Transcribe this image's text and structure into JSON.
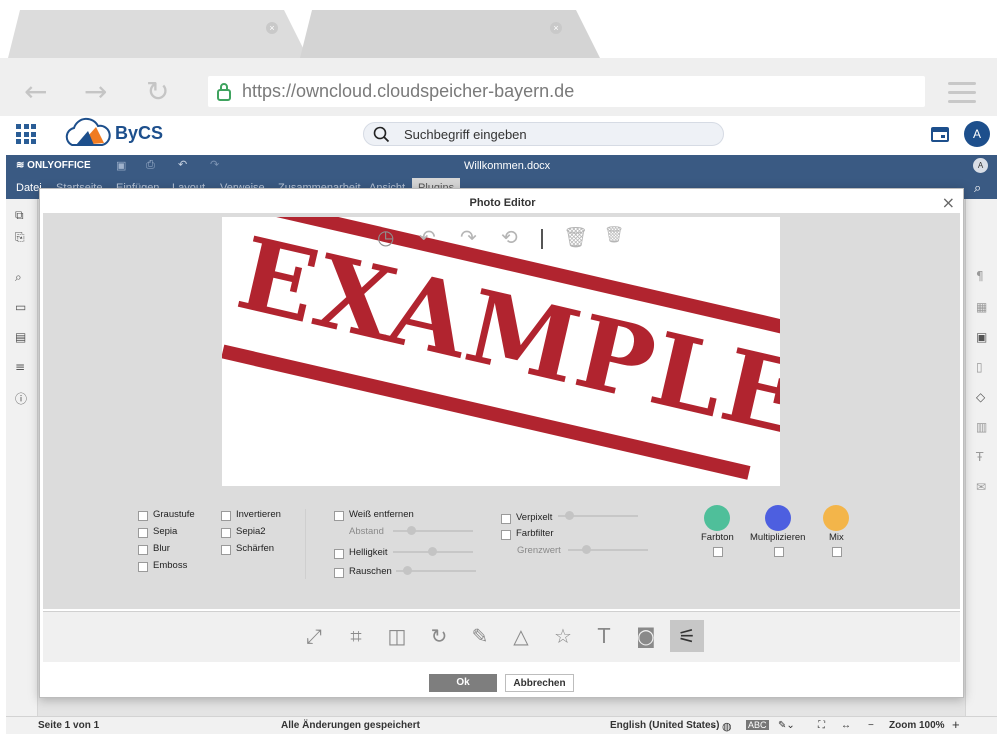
{
  "browser": {
    "url": "https://owncloud.cloudspeicher-bayern.de",
    "tabs": [
      "",
      ""
    ],
    "window_dots": [
      "#7ac943",
      "#f0bd3c",
      "#f85e55"
    ]
  },
  "app": {
    "brand": "ByCS",
    "search_placeholder": "Suchbegriff eingeben",
    "avatar_initial": "A"
  },
  "onlyoffice": {
    "brand": "ONLYOFFICE",
    "document_title": "Willkommen.docx",
    "user_initial": "A",
    "menu": [
      "Datei",
      "Startseite",
      "Einfügen",
      "Layout",
      "Verweise",
      "Zusammenarbeit",
      "Ansicht",
      "Plugins"
    ],
    "status": {
      "page": "Seite 1 von 1",
      "saved": "Alle Änderungen gespeichert",
      "language": "English (United States)",
      "zoom": "Zoom 100%"
    }
  },
  "dialog": {
    "title": "Photo Editor",
    "image_text": "EXAMPLE",
    "filters_col1": [
      "Graustufe",
      "Sepia",
      "Blur",
      "Emboss"
    ],
    "filters_col2": [
      "Invertieren",
      "Sepia2",
      "Schärfen"
    ],
    "filters_col3": {
      "remove_white": "Weiß entfernen",
      "distance": "Abstand",
      "brightness": "Helligkeit",
      "noise": "Rauschen"
    },
    "filters_col4": {
      "pixelate": "Verpixelt",
      "color_filter": "Farbfilter",
      "threshold": "Grenzwert"
    },
    "color_modes": [
      {
        "label": "Farbton",
        "color": "#4fbf9a"
      },
      {
        "label": "Multiplizieren",
        "color": "#4d5fe0"
      },
      {
        "label": "Mix",
        "color": "#f3b54a"
      }
    ],
    "ok_label": "Ok",
    "cancel_label": "Abbrechen"
  }
}
